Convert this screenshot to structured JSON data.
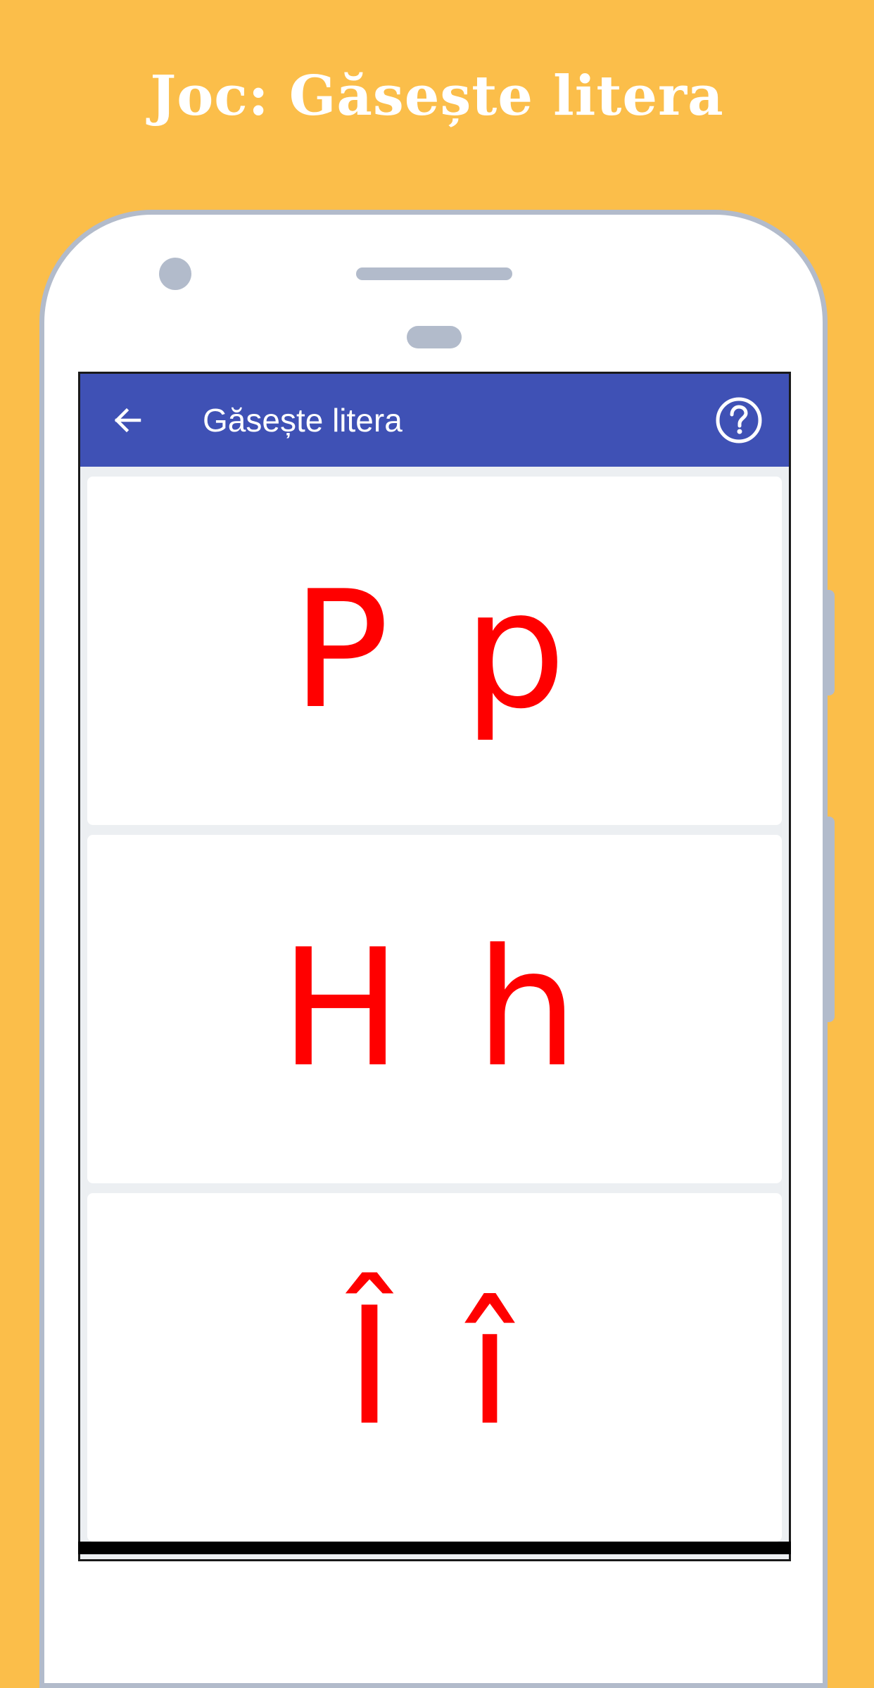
{
  "promo": {
    "title": "Joc: Găsește litera"
  },
  "appbar": {
    "back_icon": "arrow-left-icon",
    "title": "Găsește litera",
    "help_icon": "help-circle-icon"
  },
  "cards": [
    {
      "letter": "P p"
    },
    {
      "letter": "H h"
    },
    {
      "letter": "Î î"
    }
  ],
  "colors": {
    "background": "#FBBE4A",
    "appbar": "#3F51B5",
    "letters": "#FF0000",
    "phone_frame": "#B2BBCB"
  }
}
